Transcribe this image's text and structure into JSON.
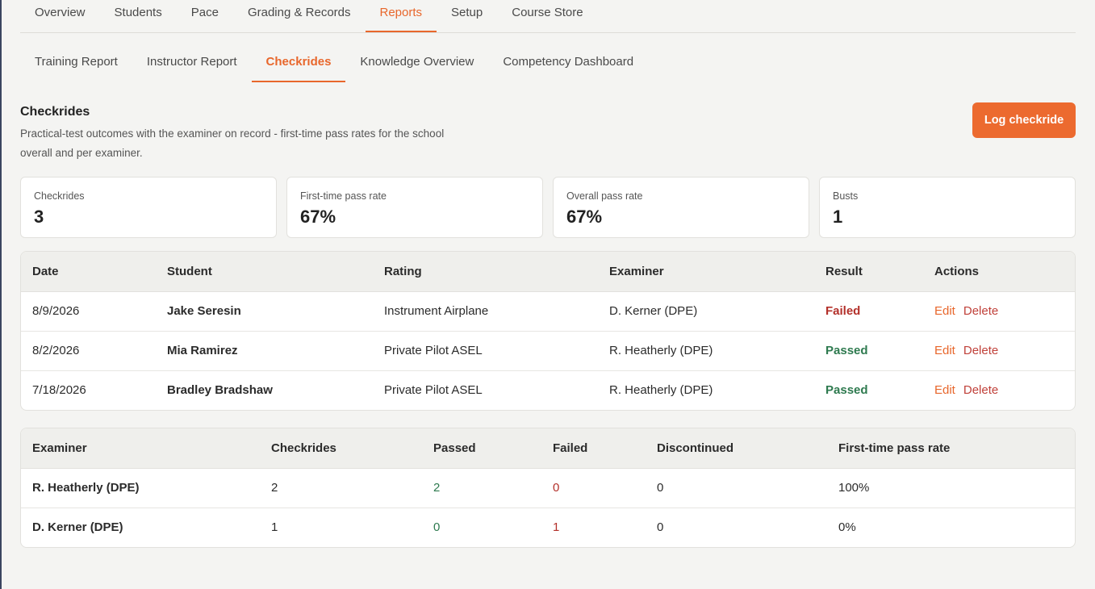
{
  "top_nav": {
    "tabs": [
      {
        "label": "Overview",
        "active": false
      },
      {
        "label": "Students",
        "active": false
      },
      {
        "label": "Pace",
        "active": false
      },
      {
        "label": "Grading & Records",
        "active": false
      },
      {
        "label": "Reports",
        "active": true
      },
      {
        "label": "Setup",
        "active": false
      },
      {
        "label": "Course Store",
        "active": false
      }
    ]
  },
  "sub_nav": {
    "tabs": [
      {
        "label": "Training Report",
        "active": false
      },
      {
        "label": "Instructor Report",
        "active": false
      },
      {
        "label": "Checkrides",
        "active": true
      },
      {
        "label": "Knowledge Overview",
        "active": false
      },
      {
        "label": "Competency Dashboard",
        "active": false
      }
    ]
  },
  "header": {
    "title": "Checkrides",
    "description": "Practical-test outcomes with the examiner on record - first-time pass rates for the school overall and per examiner.",
    "log_button": "Log checkride"
  },
  "stats": [
    {
      "label": "Checkrides",
      "value": "3"
    },
    {
      "label": "First-time pass rate",
      "value": "67%"
    },
    {
      "label": "Overall pass rate",
      "value": "67%"
    },
    {
      "label": "Busts",
      "value": "1"
    }
  ],
  "checkrides_table": {
    "columns": [
      "Date",
      "Student",
      "Rating",
      "Examiner",
      "Result",
      "Actions"
    ],
    "rows": [
      {
        "date": "8/9/2026",
        "student": "Jake Seresin",
        "rating": "Instrument Airplane",
        "examiner": "D. Kerner (DPE)",
        "result": "Failed"
      },
      {
        "date": "8/2/2026",
        "student": "Mia Ramirez",
        "rating": "Private Pilot ASEL",
        "examiner": "R. Heatherly (DPE)",
        "result": "Passed"
      },
      {
        "date": "7/18/2026",
        "student": "Bradley Bradshaw",
        "rating": "Private Pilot ASEL",
        "examiner": "R. Heatherly (DPE)",
        "result": "Passed"
      }
    ],
    "edit_label": "Edit",
    "delete_label": "Delete"
  },
  "examiner_table": {
    "columns": [
      "Examiner",
      "Checkrides",
      "Passed",
      "Failed",
      "Discontinued",
      "First-time pass rate"
    ],
    "rows": [
      {
        "examiner": "R. Heatherly (DPE)",
        "checkrides": "2",
        "passed": "2",
        "failed": "0",
        "discontinued": "0",
        "rate": "100%"
      },
      {
        "examiner": "D. Kerner (DPE)",
        "checkrides": "1",
        "passed": "0",
        "failed": "1",
        "discontinued": "0",
        "rate": "0%"
      }
    ]
  },
  "colors": {
    "accent": "#e8672c",
    "passed": "#2e7a4f",
    "failed": "#b3302a"
  }
}
